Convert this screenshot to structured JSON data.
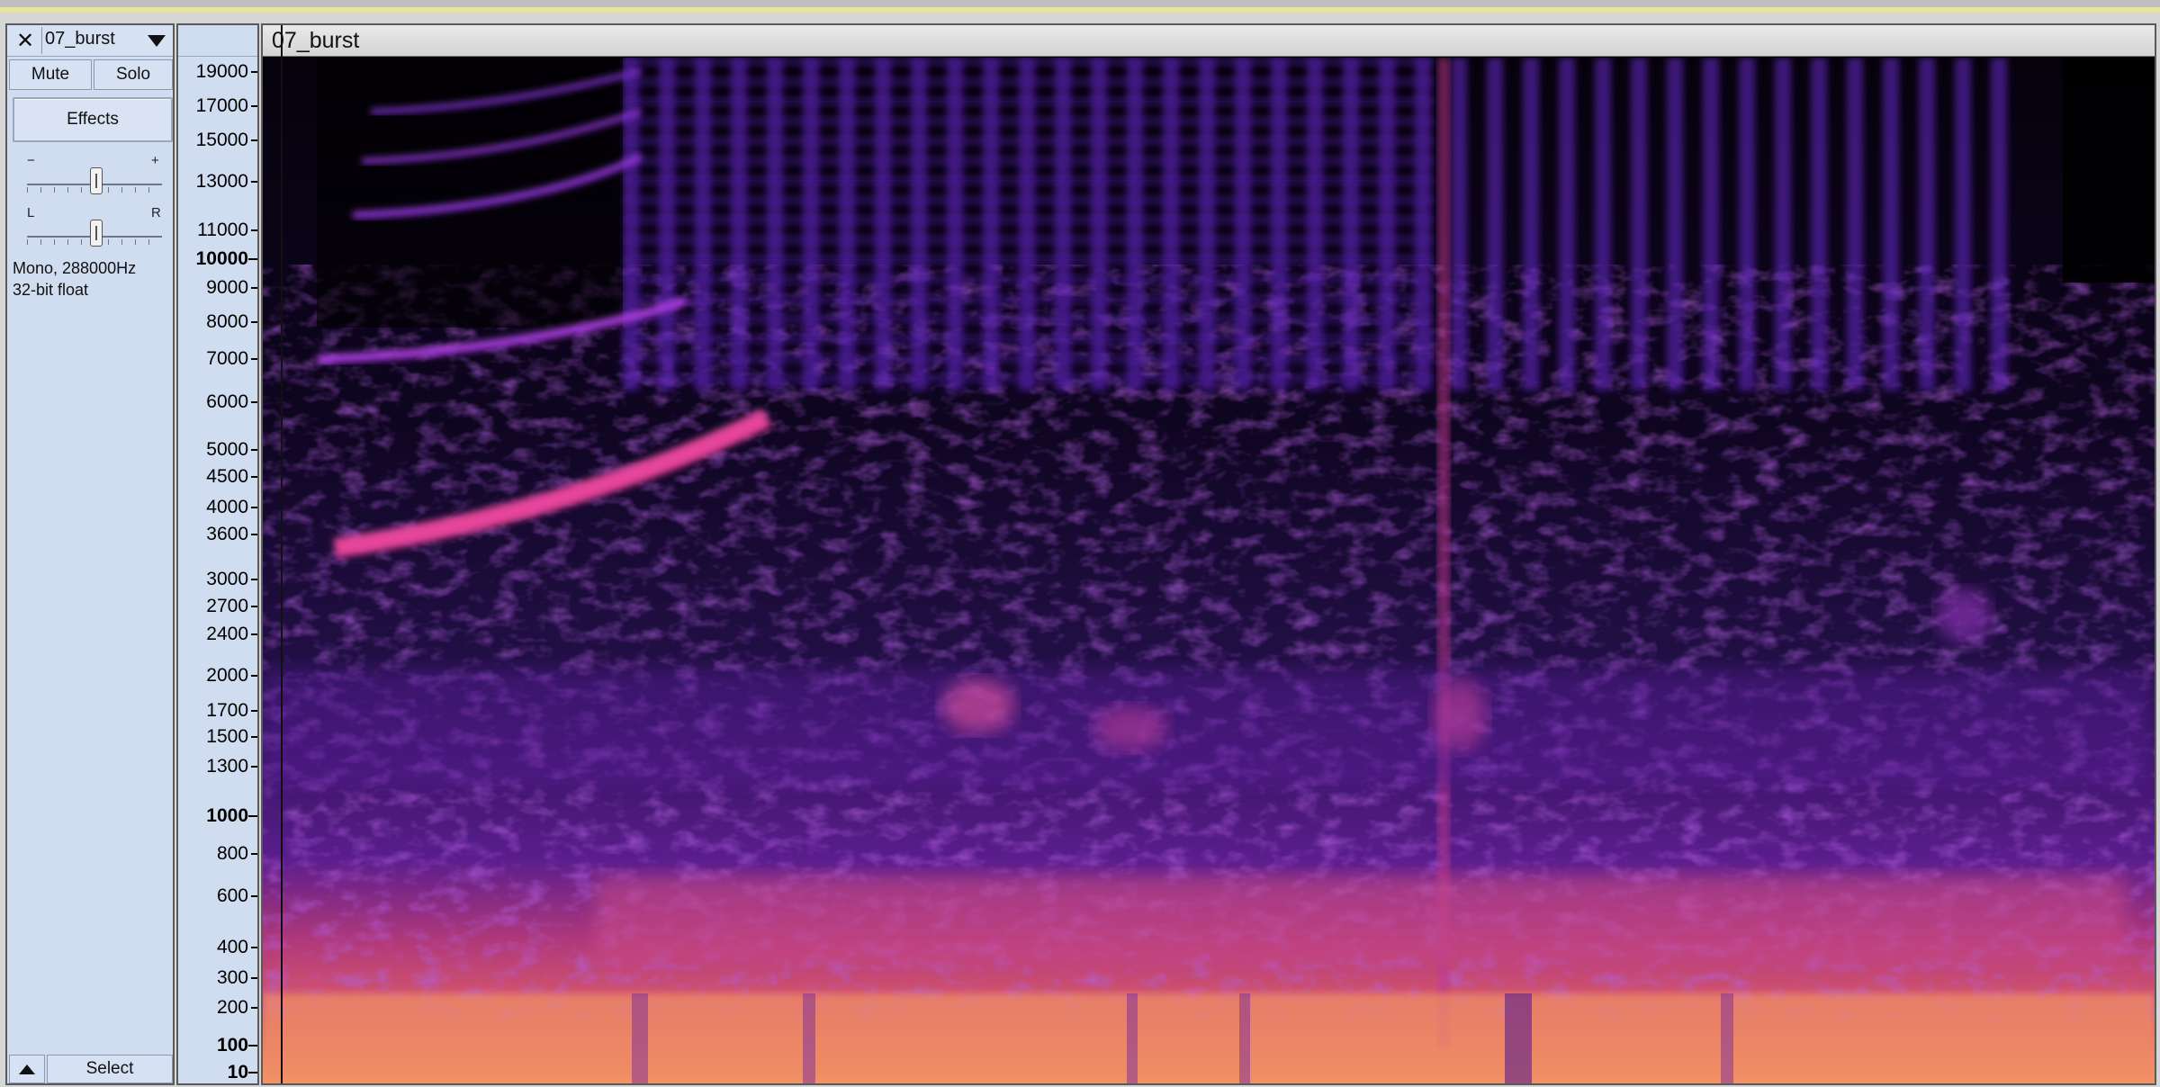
{
  "track": {
    "name": "07_burst",
    "mute_label": "Mute",
    "solo_label": "Solo",
    "effects_label": "Effects",
    "gain_minus": "−",
    "gain_plus": "+",
    "pan_left": "L",
    "pan_right": "R",
    "info_line1": "Mono, 288000Hz",
    "info_line2": "32-bit float",
    "select_label": "Select",
    "close_glyph": "✕"
  },
  "clip": {
    "title": "07_burst"
  },
  "ruler": {
    "labels": [
      "19000",
      "17000",
      "15000",
      "13000",
      "11000",
      "10000",
      "9000",
      "8000",
      "7000",
      "6000",
      "5000",
      "4500",
      "4000",
      "3600",
      "3000",
      "2700",
      "2400",
      "2000",
      "1700",
      "1500",
      "1300",
      "1000",
      "800",
      "600",
      "400",
      "300",
      "200",
      "100",
      "10"
    ],
    "major": [
      "10000",
      "1000",
      "100",
      "10"
    ]
  },
  "colors": {
    "panel_bg": "#d0dcf0",
    "spectrogram_low": "#000000",
    "spectrogram_mid": "#7a2ad0",
    "spectrogram_high": "#f7a86a"
  }
}
